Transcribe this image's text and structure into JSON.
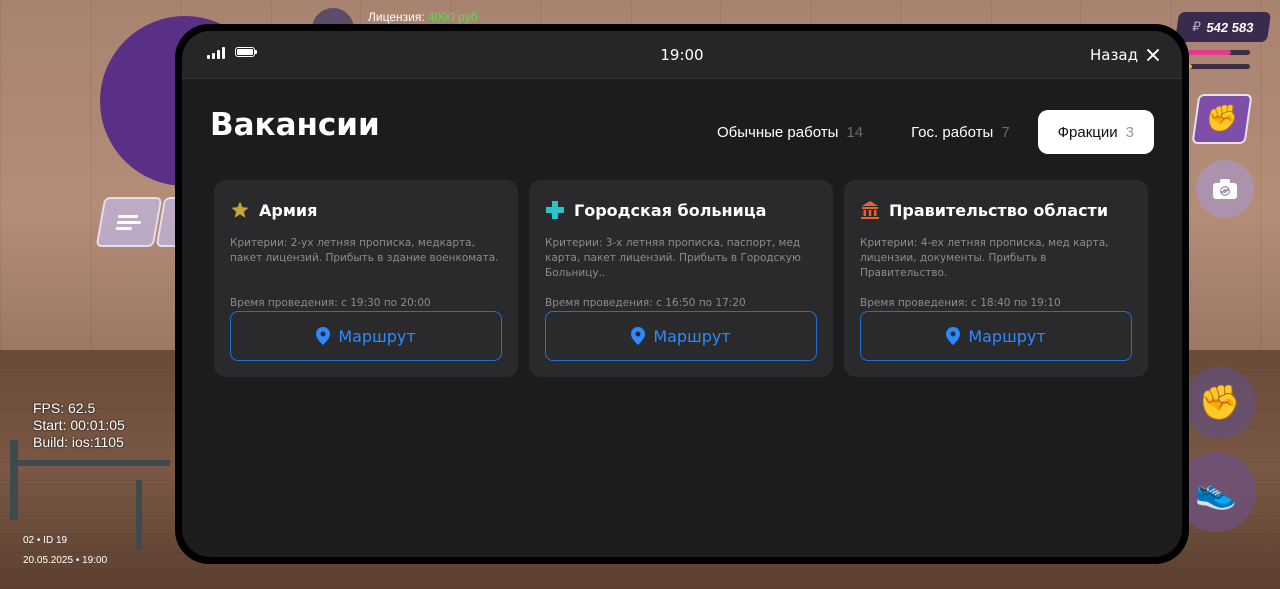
{
  "hud": {
    "license_label": "Лицензия:",
    "license_value": "4000 руб",
    "money_symbol": "₽",
    "money_amount": "542 583",
    "health_fraction": 0.7,
    "armor_fraction": 0.1,
    "debug": {
      "fps": "FPS: 62.5",
      "start": "Start: 00:01:05",
      "build": "Build: ios:1105"
    },
    "server_id": "02 • ID 19",
    "datetime": "20.05.2025 • 19:00",
    "icons": {
      "menu": "menu-icon",
      "fist": "fist-icon",
      "camera": "camera-icon",
      "punch": "punch-icon",
      "run": "sneaker-icon"
    }
  },
  "phone": {
    "time": "19:00",
    "back_label": "Назад",
    "title": "Вакансии",
    "tabs": [
      {
        "label": "Обычные работы",
        "count": "14",
        "active": false
      },
      {
        "label": "Гос. работы",
        "count": "7",
        "active": false
      },
      {
        "label": "Фракции",
        "count": "3",
        "active": true
      }
    ],
    "cards": [
      {
        "icon": "star-icon",
        "icon_color": "#c4a43b",
        "title": "Армия",
        "criteria": "Критерии: 2-ух летняя прописка, медкарта, пакет лицензий. Прибыть в здание военкомата.",
        "time": "Время проведения: с 19:30 по 20:00",
        "route_label": "Маршрут"
      },
      {
        "icon": "medical-cross-icon",
        "icon_color": "#2bc4c9",
        "title": "Городская больница",
        "criteria": "Критерии: 3-х летняя прописка, паспорт, мед карта, пакет лицензий. Прибыть в Городскую Больницу..",
        "time": "Время проведения: с 16:50 по 17:20",
        "route_label": "Маршрут"
      },
      {
        "icon": "government-building-icon",
        "icon_color": "#e8632a",
        "title": "Правительство области",
        "criteria": "Критерии: 4-ех летняя прописка, мед карта, лицензии, документы. Прибыть в Правительство.",
        "time": "Время проведения: с 18:40 по 19:10",
        "route_label": "Маршрут"
      }
    ],
    "colors": {
      "accent": "#2a8bff",
      "background": "#1c1c1e",
      "card": "#2a2a2d"
    }
  }
}
